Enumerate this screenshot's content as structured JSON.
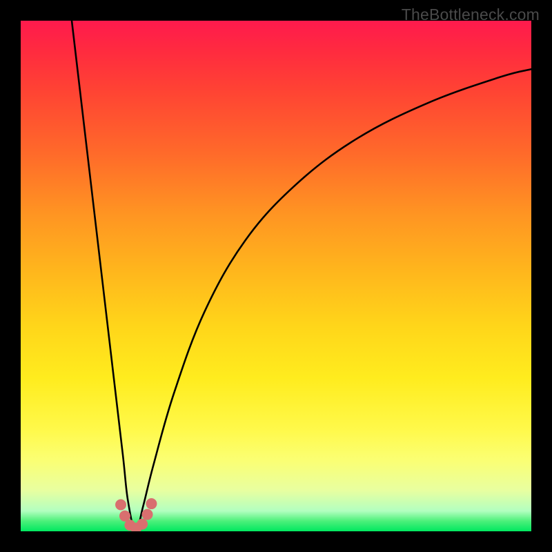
{
  "watermark": {
    "text": "TheBottleneck.com"
  },
  "colors": {
    "gradient_top": "#ff1a4d",
    "gradient_bottom": "#00e860",
    "curve_stroke": "#000000",
    "marker_fill": "#d96f6f",
    "frame": "#000000"
  },
  "chart_data": {
    "type": "line",
    "title": "",
    "xlabel": "",
    "ylabel": "",
    "xlim": [
      0,
      1
    ],
    "ylim": [
      0,
      1
    ],
    "grid": false,
    "legend": "none",
    "description": "Bottleneck curve: y ≈ |log(x / x0)| shape with a sharp V-minimum near x0 ≈ 0.22; left branch is near-vertical, right branch decays concave toward the top-right corner. Background is a red→green gradient (top→bottom) inside a black frame.",
    "series": [
      {
        "name": "bottleneck-curve",
        "x": [
          0.1,
          0.12,
          0.14,
          0.16,
          0.18,
          0.2,
          0.21,
          0.225,
          0.24,
          0.26,
          0.3,
          0.36,
          0.44,
          0.54,
          0.66,
          0.8,
          0.94,
          1.0
        ],
        "y": [
          1.0,
          0.83,
          0.66,
          0.49,
          0.32,
          0.15,
          0.06,
          0.0,
          0.05,
          0.13,
          0.27,
          0.43,
          0.57,
          0.68,
          0.77,
          0.84,
          0.89,
          0.905
        ]
      }
    ],
    "markers": [
      {
        "x": 0.196,
        "y": 0.052
      },
      {
        "x": 0.204,
        "y": 0.03
      },
      {
        "x": 0.214,
        "y": 0.012
      },
      {
        "x": 0.226,
        "y": 0.006
      },
      {
        "x": 0.238,
        "y": 0.014
      },
      {
        "x": 0.248,
        "y": 0.033
      },
      {
        "x": 0.256,
        "y": 0.054
      }
    ]
  }
}
